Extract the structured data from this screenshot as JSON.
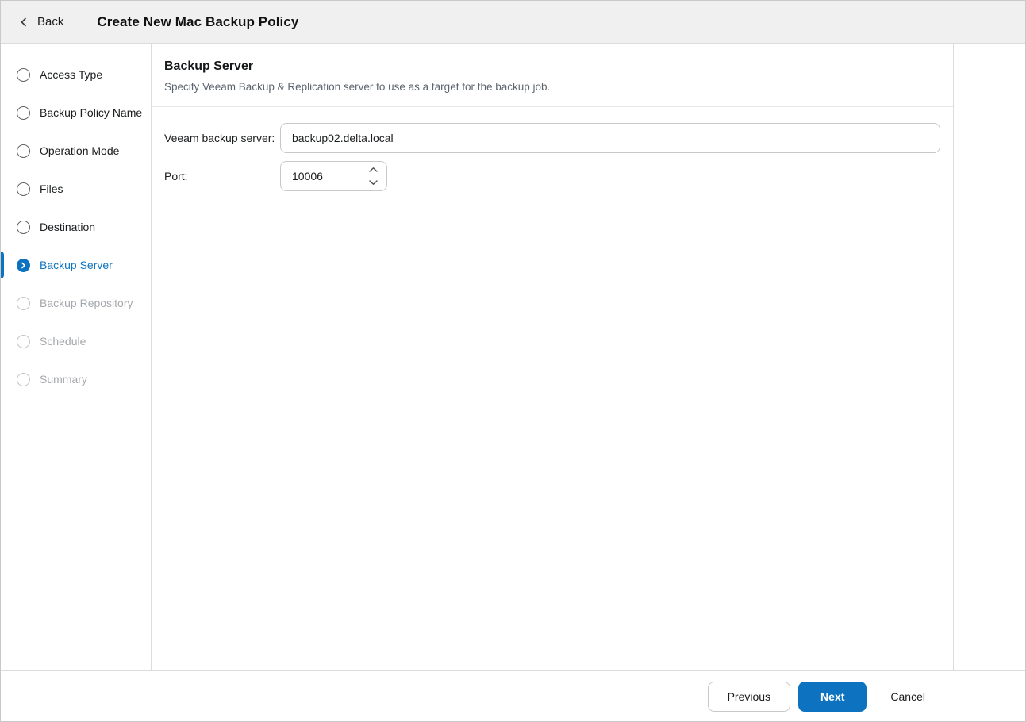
{
  "header": {
    "back_label": "Back",
    "title": "Create New Mac Backup Policy"
  },
  "sidebar": {
    "steps": [
      {
        "label": "Access Type",
        "state": "pending"
      },
      {
        "label": "Backup Policy Name",
        "state": "pending"
      },
      {
        "label": "Operation Mode",
        "state": "pending"
      },
      {
        "label": "Files",
        "state": "pending"
      },
      {
        "label": "Destination",
        "state": "pending"
      },
      {
        "label": "Backup Server",
        "state": "active"
      },
      {
        "label": "Backup Repository",
        "state": "future"
      },
      {
        "label": "Schedule",
        "state": "future"
      },
      {
        "label": "Summary",
        "state": "future"
      }
    ]
  },
  "main": {
    "section_title": "Backup Server",
    "section_description": "Specify Veeam Backup & Replication server to use as a target for the backup job.",
    "form": {
      "server_label": "Veeam backup server:",
      "server_value": "backup02.delta.local",
      "port_label": "Port:",
      "port_value": "10006"
    }
  },
  "footer": {
    "previous_label": "Previous",
    "next_label": "Next",
    "cancel_label": "Cancel"
  },
  "colors": {
    "accent_blue": "#0d73c0",
    "header_bg": "#f0f0f0",
    "border": "#dcdcdc",
    "muted_text": "#5d6670",
    "disabled_text": "#a5a8ac"
  }
}
